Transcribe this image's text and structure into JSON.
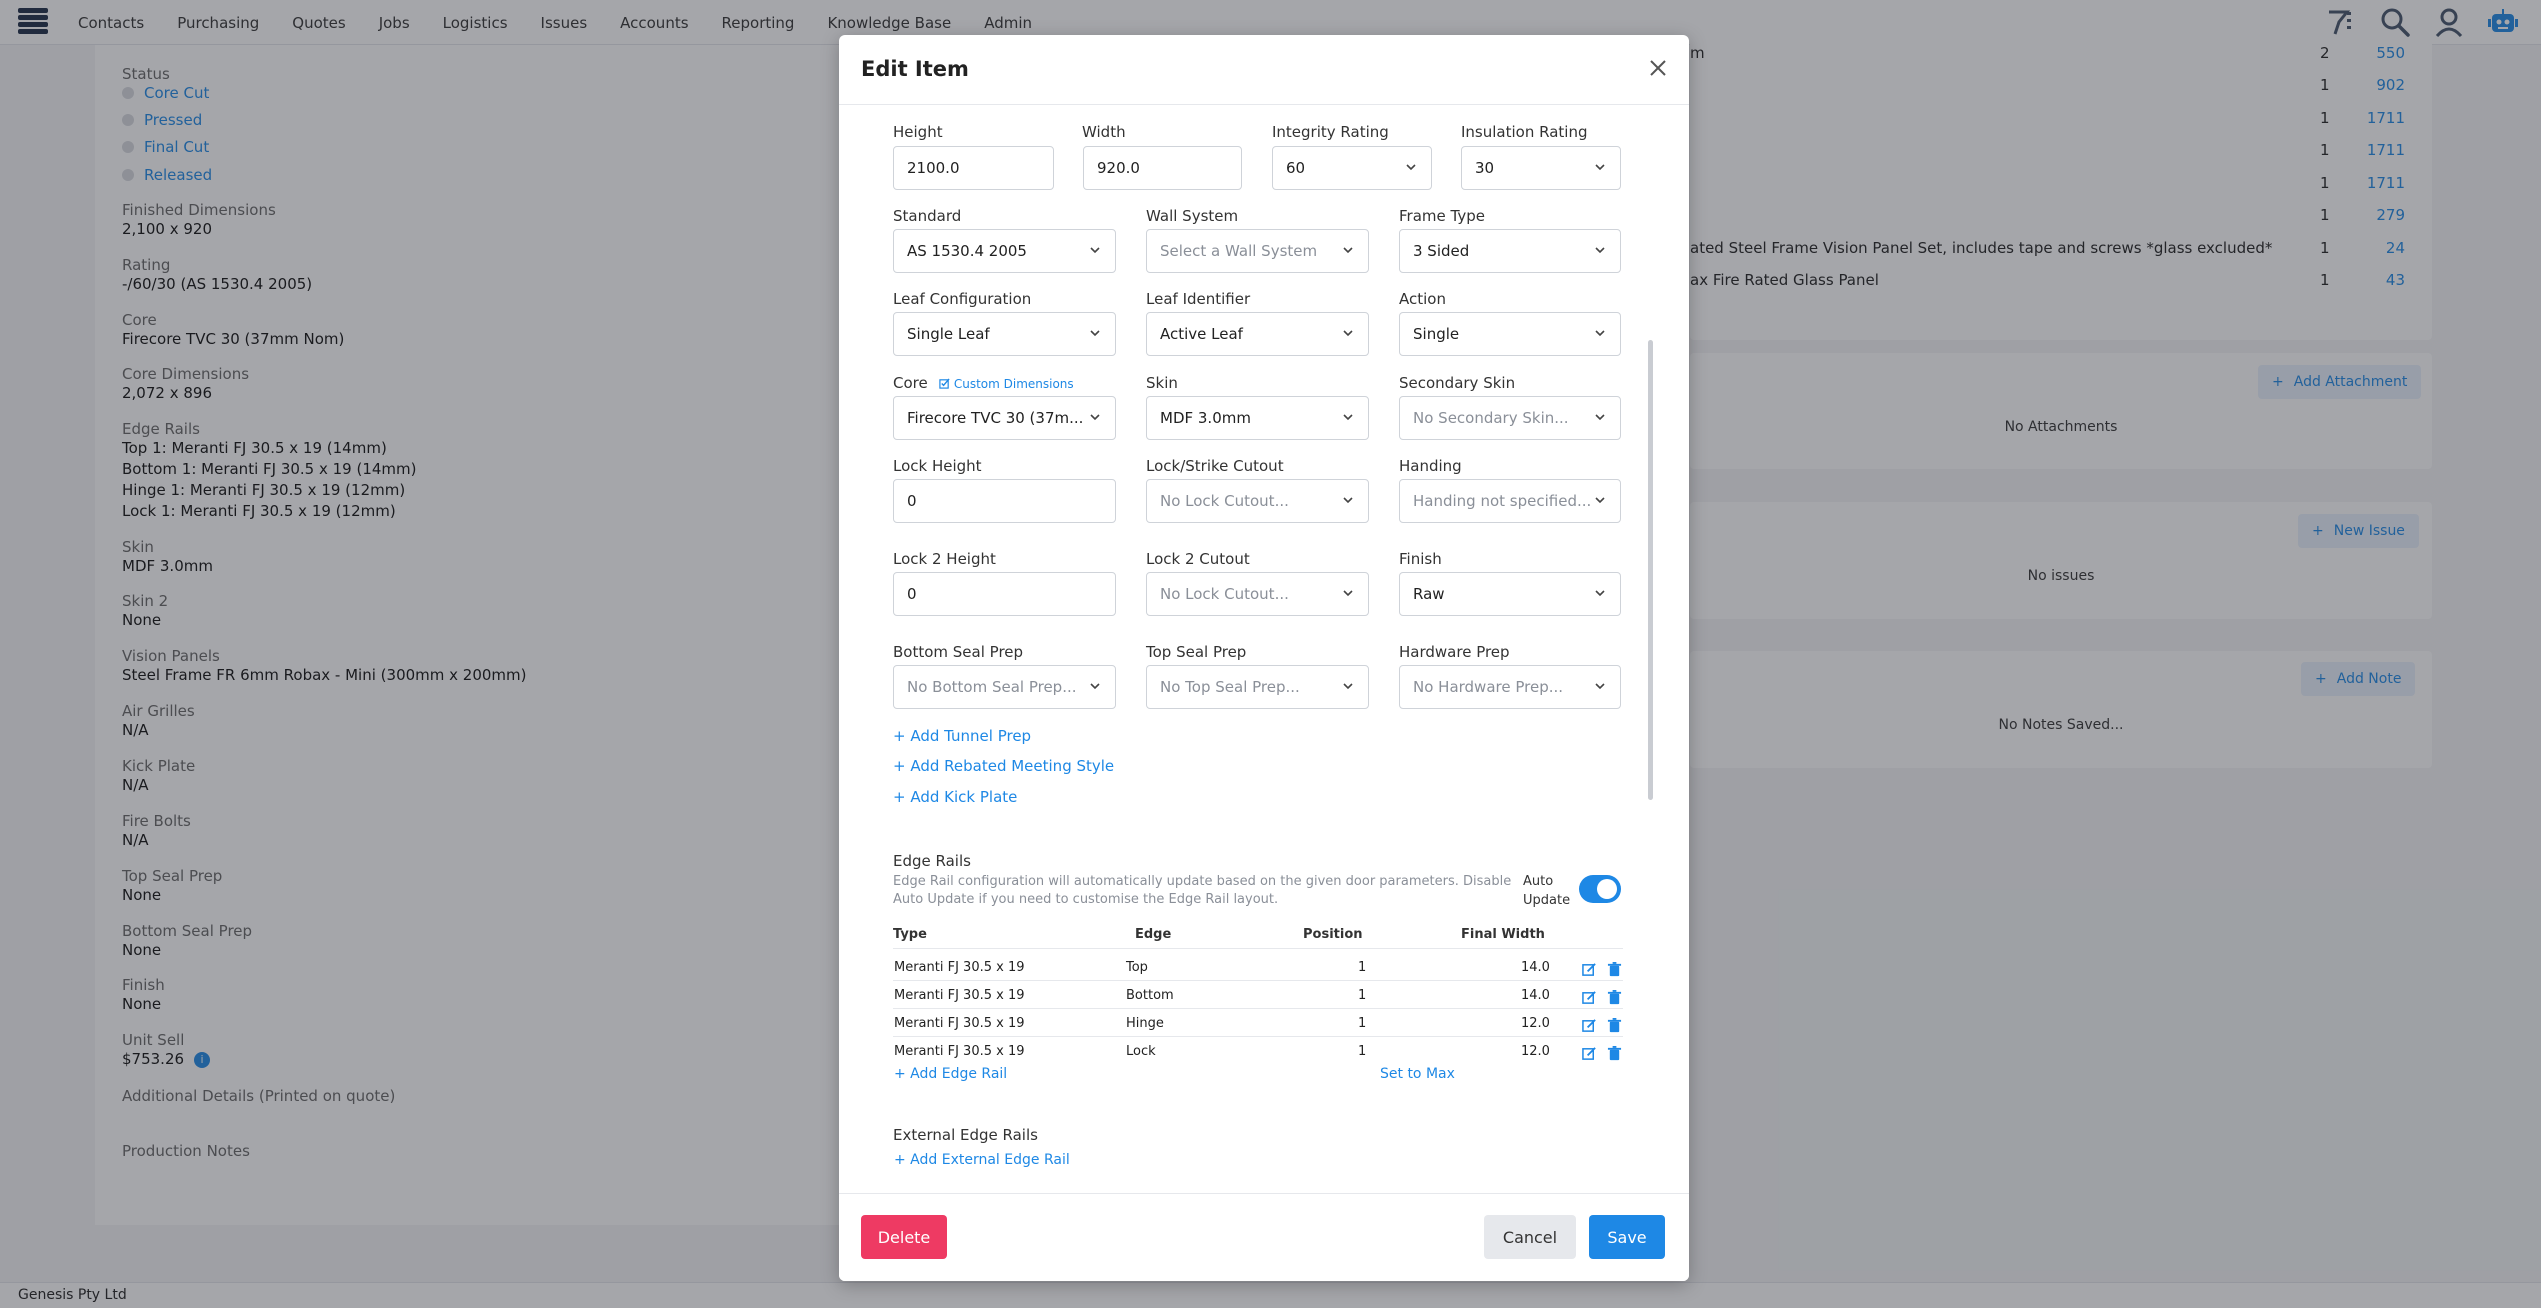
{
  "app": {
    "nav": [
      "Contacts",
      "Purchasing",
      "Quotes",
      "Jobs",
      "Logistics",
      "Issues",
      "Accounts",
      "Reporting",
      "Knowledge Base",
      "Admin"
    ],
    "footer_company": "Genesis Pty Ltd"
  },
  "details": {
    "status_label": "Status",
    "statuses": [
      "Core Cut",
      "Pressed",
      "Final Cut",
      "Released"
    ],
    "fields": [
      {
        "label": "Finished Dimensions",
        "value": "2,100 x 920"
      },
      {
        "label": "Rating",
        "value": "-/60/30 (AS 1530.4 2005)"
      },
      {
        "label": "Core",
        "value": "Firecore TVC 30 (37mm Nom)"
      },
      {
        "label": "Core Dimensions",
        "value": "2,072 x 896"
      }
    ],
    "edge_rails_label": "Edge Rails",
    "edge_rails_lines": [
      "Top 1: Meranti FJ 30.5 x 19 (14mm)",
      "Bottom 1: Meranti FJ 30.5 x 19 (14mm)",
      "Hinge 1: Meranti FJ 30.5 x 19 (12mm)",
      "Lock 1: Meranti FJ 30.5 x 19 (12mm)"
    ],
    "fields2": [
      {
        "label": "Skin",
        "value": "MDF 3.0mm"
      },
      {
        "label": "Skin 2",
        "value": "None"
      },
      {
        "label": "Vision Panels",
        "value": "Steel Frame FR 6mm Robax - Mini (300mm x 200mm)"
      },
      {
        "label": "Air Grilles",
        "value": "N/A"
      },
      {
        "label": "Kick Plate",
        "value": "N/A"
      },
      {
        "label": "Fire Bolts",
        "value": "N/A"
      },
      {
        "label": "Top Seal Prep",
        "value": "None"
      },
      {
        "label": "Bottom Seal Prep",
        "value": "None"
      },
      {
        "label": "Finish",
        "value": "None"
      },
      {
        "label": "Unit Sell",
        "value": "$753.26"
      }
    ],
    "additional_details_label": "Additional Details (Printed on quote)",
    "production_notes_label": "Production Notes"
  },
  "side": {
    "rows": [
      {
        "desc": "m",
        "qty": "2",
        "val": "550"
      },
      {
        "desc": "",
        "qty": "1",
        "val": "902"
      },
      {
        "desc": "",
        "qty": "1",
        "val": "1711"
      },
      {
        "desc": "",
        "qty": "1",
        "val": "1711"
      },
      {
        "desc": "",
        "qty": "1",
        "val": "1711"
      },
      {
        "desc": "",
        "qty": "1",
        "val": "279"
      },
      {
        "desc": "ated Steel Frame Vision Panel Set, includes tape and screws *glass excluded*",
        "qty": "1",
        "val": "24"
      },
      {
        "desc": "ax Fire Rated Glass Panel",
        "qty": "1",
        "val": "43"
      }
    ],
    "add_attachment": "Add Attachment",
    "no_attachments": "No Attachments",
    "new_issue": "New Issue",
    "no_issues": "No issues",
    "add_note": "Add Note",
    "no_notes": "No Notes Saved..."
  },
  "modal": {
    "title": "Edit Item",
    "top_partial_labels": [
      "Height",
      "Width",
      "Integrity Rating",
      "Insulation Rating"
    ],
    "height": "2100.0",
    "width": "920.0",
    "integrity_rating": "60",
    "insulation_rating": "30",
    "standard_label": "Standard",
    "standard": "AS 1530.4 2005",
    "wall_system_label": "Wall System",
    "wall_system_ph": "Select a Wall System",
    "frame_type_label": "Frame Type",
    "frame_type": "3 Sided",
    "leaf_config_label": "Leaf Configuration",
    "leaf_config": "Single Leaf",
    "leaf_identifier_label": "Leaf Identifier",
    "leaf_identifier": "Active Leaf",
    "action_label": "Action",
    "action": "Single",
    "core_label": "Core",
    "custom_dimensions": "Custom Dimensions",
    "core": "Firecore TVC 30 (37m...",
    "skin_label": "Skin",
    "skin": "MDF 3.0mm",
    "secondary_skin_label": "Secondary Skin",
    "secondary_skin_ph": "No Secondary Skin...",
    "lock_height_label": "Lock Height",
    "lock_height": "0",
    "lock_cutout_label": "Lock/Strike Cutout",
    "lock_cutout_ph": "No Lock Cutout...",
    "handing_label": "Handing",
    "handing_ph": "Handing not specified...",
    "lock2_height_label": "Lock 2 Height",
    "lock2_height": "0",
    "lock2_cutout_label": "Lock 2 Cutout",
    "lock2_cutout_ph": "No Lock Cutout...",
    "finish_label": "Finish",
    "finish": "Raw",
    "bottom_seal_label": "Bottom Seal Prep",
    "bottom_seal_ph": "No Bottom Seal Prep...",
    "top_seal_label": "Top Seal Prep",
    "top_seal_ph": "No Top Seal Prep...",
    "hardware_prep_label": "Hardware Prep",
    "hardware_prep_ph": "No Hardware Prep...",
    "add_tunnel_prep": "+ Add Tunnel Prep",
    "add_rebated": "+ Add Rebated Meeting Style",
    "add_kick_plate": "+ Add Kick Plate",
    "edge_rails_title": "Edge Rails",
    "edge_rails_help_1": "Edge Rail configuration will automatically update based on the given door parameters. Disable",
    "edge_rails_help_2": "Auto Update if you need to customise the Edge Rail layout.",
    "auto_update_1": "Auto",
    "auto_update_2": "Update",
    "auto_update_on": true,
    "table_headers": [
      "Type",
      "Edge",
      "Position",
      "Final Width"
    ],
    "table_rows": [
      {
        "type": "Meranti FJ 30.5 x 19",
        "edge": "Top",
        "position": "1",
        "final_width": "14.0"
      },
      {
        "type": "Meranti FJ 30.5 x 19",
        "edge": "Bottom",
        "position": "1",
        "final_width": "14.0"
      },
      {
        "type": "Meranti FJ 30.5 x 19",
        "edge": "Hinge",
        "position": "1",
        "final_width": "12.0"
      },
      {
        "type": "Meranti FJ 30.5 x 19",
        "edge": "Lock",
        "position": "1",
        "final_width": "12.0"
      }
    ],
    "add_edge_rail": "+ Add Edge Rail",
    "set_to_max": "Set to Max",
    "external_edge_rails": "External Edge Rails",
    "add_external_edge_rail": "+ Add External Edge Rail",
    "delete": "Delete",
    "cancel": "Cancel",
    "save": "Save"
  }
}
